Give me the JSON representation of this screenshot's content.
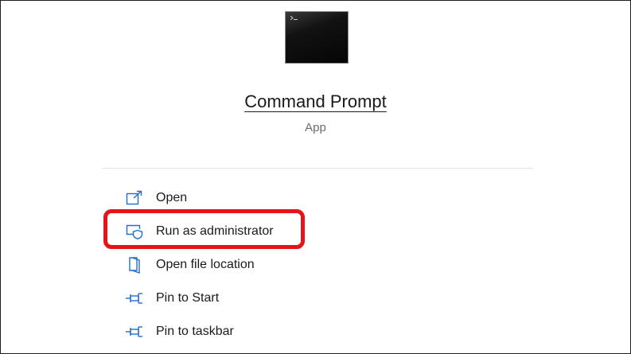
{
  "app": {
    "title": "Command Prompt",
    "type": "App",
    "icon": "command-prompt-icon"
  },
  "menu": {
    "items": [
      {
        "label": "Open",
        "icon": "open-icon"
      },
      {
        "label": "Run as administrator",
        "icon": "shield-admin-icon"
      },
      {
        "label": "Open file location",
        "icon": "folder-icon"
      },
      {
        "label": "Pin to Start",
        "icon": "pin-icon"
      },
      {
        "label": "Pin to taskbar",
        "icon": "pin-icon"
      }
    ]
  },
  "highlight": {
    "target": "Run as administrator",
    "color": "#e5141b"
  },
  "colors": {
    "icon_accent": "#1f6fd0"
  }
}
